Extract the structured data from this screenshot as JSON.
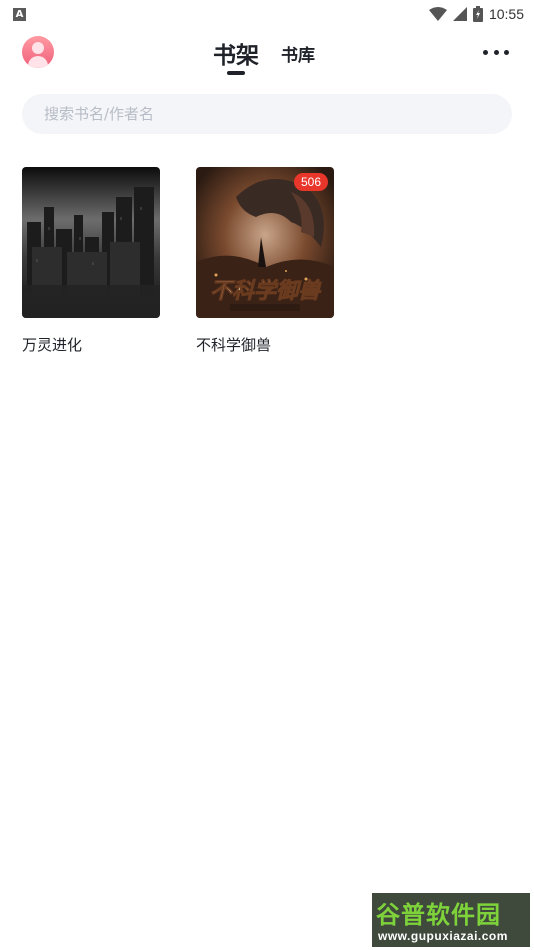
{
  "status_bar": {
    "notification_glyph": "A",
    "time": "10:55"
  },
  "header": {
    "tabs": [
      {
        "label": "书架",
        "active": true
      },
      {
        "label": "书库",
        "active": false
      }
    ]
  },
  "search": {
    "placeholder": "搜索书名/作者名",
    "value": ""
  },
  "books": [
    {
      "title": "万灵进化",
      "badge": ""
    },
    {
      "title": "不科学御兽",
      "badge": "506"
    }
  ],
  "watermark": {
    "title": "谷普软件园",
    "url": "www.gupuxiazai.com"
  },
  "colors": {
    "text_primary": "#1f2329",
    "search_bg": "#f4f5f8",
    "badge": "#e8362b",
    "avatar": "#f0607a"
  }
}
